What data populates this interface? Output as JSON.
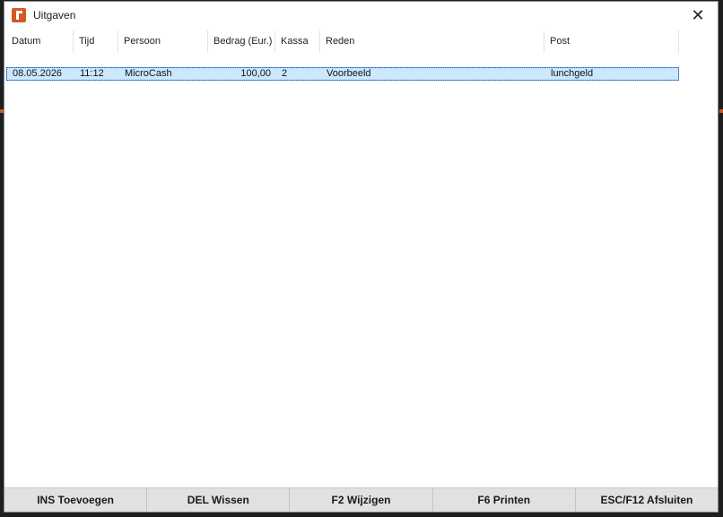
{
  "window": {
    "title": "Uitgaven",
    "close_glyph": "✕"
  },
  "columns": [
    "Datum",
    "Tijd",
    "Persoon",
    "Bedrag (Eur.)",
    "Kassa",
    "Reden",
    "Post"
  ],
  "rows": [
    {
      "datum": "08.05.2026",
      "tijd": "11:12",
      "persoon": "MicroCash",
      "bedrag": "100,00",
      "kassa": "2",
      "reden": "Voorbeeld",
      "post": "lunchgeld"
    }
  ],
  "footer": {
    "add": "INS Toevoegen",
    "delete": "DEL Wissen",
    "edit": "F2 Wijzigen",
    "print": "F6 Printen",
    "close": "ESC/F12 Afsluiten"
  },
  "colors": {
    "accent": "#d35a27",
    "selection": "#cce8ff"
  }
}
